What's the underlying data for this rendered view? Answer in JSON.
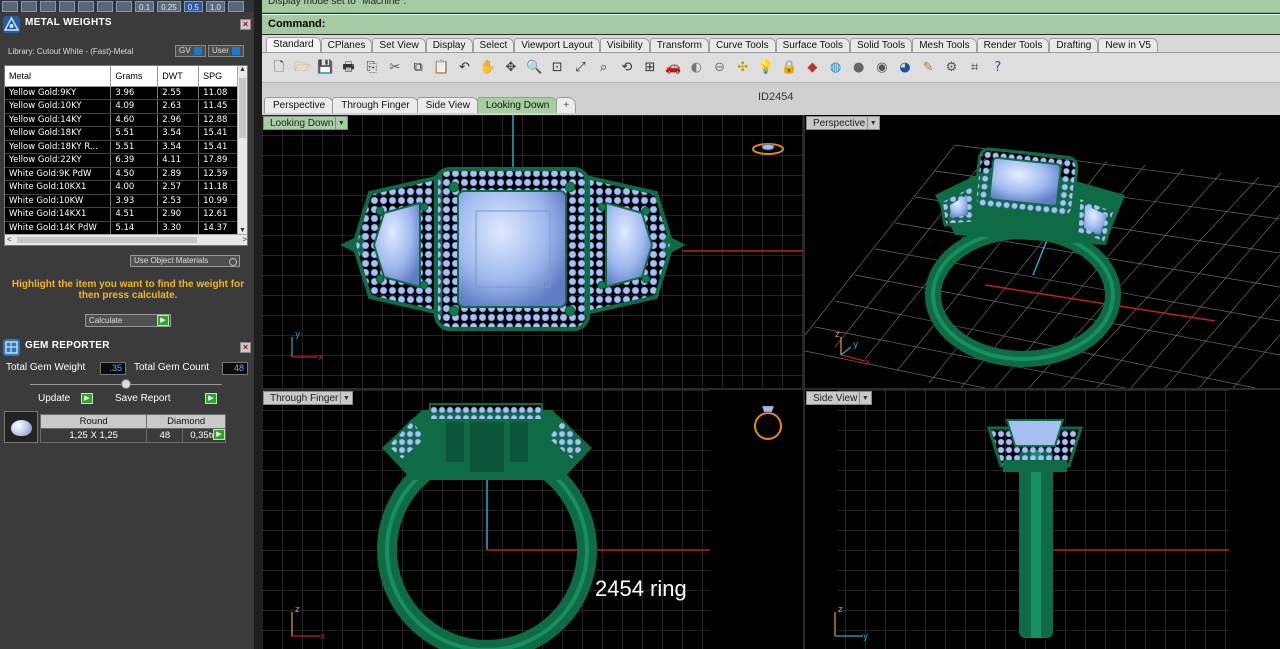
{
  "left_panel": {
    "metal_weights": {
      "title": "METAL WEIGHTS",
      "library": "Library: Cutout White - (Fast)-Metal",
      "gv_label": "GV",
      "user_label": "User",
      "columns": [
        "Metal",
        "Grams",
        "DWT",
        "SPG"
      ],
      "rows": [
        {
          "metal": "Yellow Gold:9KY",
          "grams": "3.96",
          "dwt": "2.55",
          "spg": "11.08"
        },
        {
          "metal": "Yellow Gold:10KY",
          "grams": "4.09",
          "dwt": "2.63",
          "spg": "11.45"
        },
        {
          "metal": "Yellow Gold:14KY",
          "grams": "4.60",
          "dwt": "2.96",
          "spg": "12.88"
        },
        {
          "metal": "Yellow Gold:18KY",
          "grams": "5.51",
          "dwt": "3.54",
          "spg": "15.41"
        },
        {
          "metal": "Yellow Gold:18KY R...",
          "grams": "5.51",
          "dwt": "3.54",
          "spg": "15.41"
        },
        {
          "metal": "Yellow Gold:22KY",
          "grams": "6.39",
          "dwt": "4.11",
          "spg": "17.89"
        },
        {
          "metal": "White Gold:9K PdW",
          "grams": "4.50",
          "dwt": "2.89",
          "spg": "12.59"
        },
        {
          "metal": "White Gold:10KX1",
          "grams": "4.00",
          "dwt": "2.57",
          "spg": "11.18"
        },
        {
          "metal": "White Gold:10KW",
          "grams": "3.93",
          "dwt": "2.53",
          "spg": "10.99"
        },
        {
          "metal": "White Gold:14KX1",
          "grams": "4.51",
          "dwt": "2.90",
          "spg": "12.61"
        },
        {
          "metal": "White Gold:14K PdW",
          "grams": "5.14",
          "dwt": "3.30",
          "spg": "14.37"
        }
      ],
      "use_object_materials": "Use Object Materials",
      "highlight_text": "Highlight the item you want to find the weight for then press calculate.",
      "calculate_label": "Calculate"
    },
    "gem_reporter": {
      "title": "GEM REPORTER",
      "total_weight_label": "Total Gem Weight",
      "total_weight_value": ".35",
      "total_count_label": "Total Gem Count",
      "total_count_value": "48",
      "update_label": "Update",
      "save_report_label": "Save Report",
      "gem_header": [
        "Round",
        "Diamond"
      ],
      "gem_row": {
        "size": "1,25 X 1,25",
        "count": "48",
        "weight": "0,35tw"
      }
    },
    "top_strip_values": [
      "0.1",
      "0.25",
      "0.5",
      "1.0"
    ]
  },
  "command": {
    "history_text": "Display mode set to \"Machine\".",
    "prompt": "Command:"
  },
  "toolbar_tabs": [
    "Standard",
    "CPlanes",
    "Set View",
    "Display",
    "Select",
    "Viewport Layout",
    "Visibility",
    "Transform",
    "Curve Tools",
    "Surface Tools",
    "Solid Tools",
    "Mesh Tools",
    "Render Tools",
    "Drafting",
    "New in V5"
  ],
  "toolbar_icons": [
    "new-file",
    "open-folder",
    "save",
    "print",
    "import",
    "cut",
    "copy",
    "paste",
    "undo",
    "pan-hand",
    "move",
    "zoom",
    "zoom-window",
    "zoom-extents",
    "zoom-selected",
    "rotate-view",
    "four-viewports",
    "car",
    "hide",
    "lock",
    "point",
    "bulb",
    "padlock",
    "layer",
    "color-wheel",
    "sphere-gray",
    "sphere-shaded",
    "sphere-blue",
    "pen",
    "gear",
    "snap",
    "help"
  ],
  "viewport_tabs": [
    "Perspective",
    "Through Finger",
    "Side View",
    "Looking Down"
  ],
  "id_label": "ID2454",
  "viewports": {
    "top_left": "Looking Down",
    "top_right": "Perspective",
    "bottom_left": "Through Finger",
    "bottom_right": "Side View"
  },
  "caption": "2454 ring",
  "colors": {
    "metal_green": "#0e6b46",
    "gem_blue": "#a9c3f2",
    "command_green": "#a5c9a0",
    "grid": "#5c5c5c",
    "axis_red": "#c02020",
    "axis_cyan": "#2aa8c8"
  }
}
